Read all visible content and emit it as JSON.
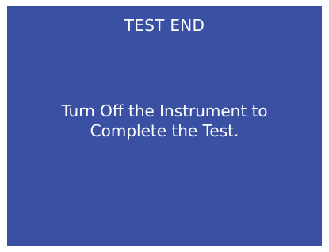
{
  "screen": {
    "title": "TEST END",
    "message_lines": [
      "Turn Off the Instrument to",
      "Complete the Test."
    ]
  },
  "colors": {
    "screen_background": "#3a51a3",
    "text": "#ffffff",
    "page_background": "#ffffff"
  }
}
